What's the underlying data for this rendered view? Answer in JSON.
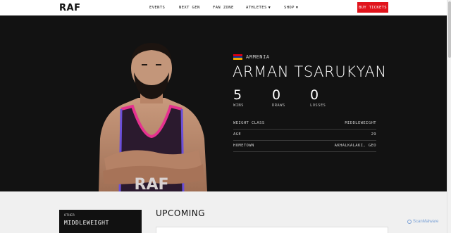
{
  "nav": {
    "logo": "RAF",
    "links": [
      "EVENTS",
      "NEXT GEN",
      "FAN ZONE",
      "ATHLETES",
      "SHOP"
    ],
    "buy_label": "BUY TICKETS",
    "buy_color": "#e1141c"
  },
  "athlete": {
    "country": "ARMENIA",
    "flag_colors": [
      "#d90012",
      "#0033a0",
      "#f2a800"
    ],
    "name": "ARMAN TSARUKYAN",
    "photo_text": "RAF",
    "stats": [
      {
        "value": "5",
        "label": "WINS"
      },
      {
        "value": "0",
        "label": "DRAWS"
      },
      {
        "value": "0",
        "label": "LOSSES"
      }
    ],
    "info": [
      {
        "label": "WEIGHT CLASS",
        "value": "MIDDLEWEIGHT"
      },
      {
        "label": "AGE",
        "value": "29"
      },
      {
        "label": "HOMETOWN",
        "value": "AKHALKALAKI, GEO"
      }
    ]
  },
  "lower": {
    "other_small": "OTHER",
    "other_big": "MIDDLEWEIGHT",
    "upcoming_title": "UPCOMING"
  },
  "watermark": "ScanMalware"
}
